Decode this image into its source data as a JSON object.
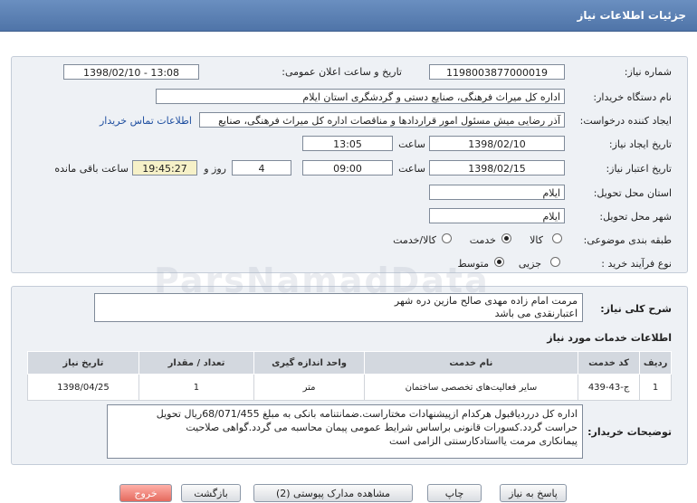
{
  "window": {
    "title": "جزئیات اطلاعات نیاز"
  },
  "form": {
    "need_number_label": "شماره نیاز:",
    "need_number": "1198003877000019",
    "announce_label": "تاریخ و ساعت اعلان عمومی:",
    "announce_value": "1398/02/10 - 13:08",
    "buyer_label": "نام دستگاه خریدار:",
    "buyer_value": "اداره کل میراث فرهنگی، صنایع دستی و گردشگری استان ایلام",
    "requester_label": "ایجاد کننده درخواست:",
    "requester_value": "آذر رضایی میش مسئول امور قراردادها و مناقصات اداره کل میراث فرهنگی، صنایع",
    "contact_link": "اطلاعات تماس خریدار",
    "created_label": "تاریخ ایجاد نیاز:",
    "created_date": "1398/02/10",
    "created_time_label": "ساعت",
    "created_time": "13:05",
    "validity_label": "تاریخ اعتبار نیاز:",
    "validity_date": "1398/02/15",
    "validity_time_label": "ساعت",
    "validity_time": "09:00",
    "days_value": "4",
    "days_label": "روز و",
    "remaining_time": "19:45:27",
    "remaining_label": "ساعت باقی مانده",
    "province_label": "استان محل تحویل:",
    "province_value": "ایلام",
    "city_label": "شهر محل تحویل:",
    "city_value": "ایلام",
    "category_label": "طبقه بندی موضوعی:",
    "category_options": [
      "کالا",
      "خدمت",
      "کالا/خدمت"
    ],
    "category_selected": 1,
    "process_label": "نوع فرآیند خرید :",
    "process_options": [
      "جزیی",
      "متوسط"
    ],
    "process_selected": 1
  },
  "summary": {
    "label": "شرح کلی نیاز:",
    "line1": "مرمت امام زاده مهدی صالح مازین دره شهر",
    "line2": "اعتبارنقدی می باشد"
  },
  "services": {
    "title": "اطلاعات خدمات مورد نیاز",
    "headers": [
      "ردیف",
      "کد خدمت",
      "نام خدمت",
      "واحد اندازه گیری",
      "تعداد / مقدار",
      "تاریخ نیاز"
    ],
    "rows": [
      [
        "1",
        "ج-43-439",
        "سایر فعالیت‌های تخصصی ساختمان",
        "متر",
        "1",
        "1398/04/25"
      ]
    ]
  },
  "buyer_notes": {
    "label": "توضیحات خریدار:",
    "line1": "اداره کل درردیاقبول هرکدام ازپیشنهادات مختاراست.ضمانتنامه بانکی به مبلغ 68/071/455ریال تحویل",
    "line2": "حراست گردد.کسورات قانونی براساس شرایط عمومی پیمان محاسبه می گردد.گواهی صلاحیت",
    "line3": "پیمانکاری مرمت یااستادکارسنتی الزامی است"
  },
  "buttons": {
    "reply": "پاسخ به نیاز",
    "print": "چاپ",
    "attachments": "مشاهده مدارک پیوستی (2)",
    "back": "بازگشت",
    "exit": "خروج"
  },
  "watermark": "ParsNamadData"
}
